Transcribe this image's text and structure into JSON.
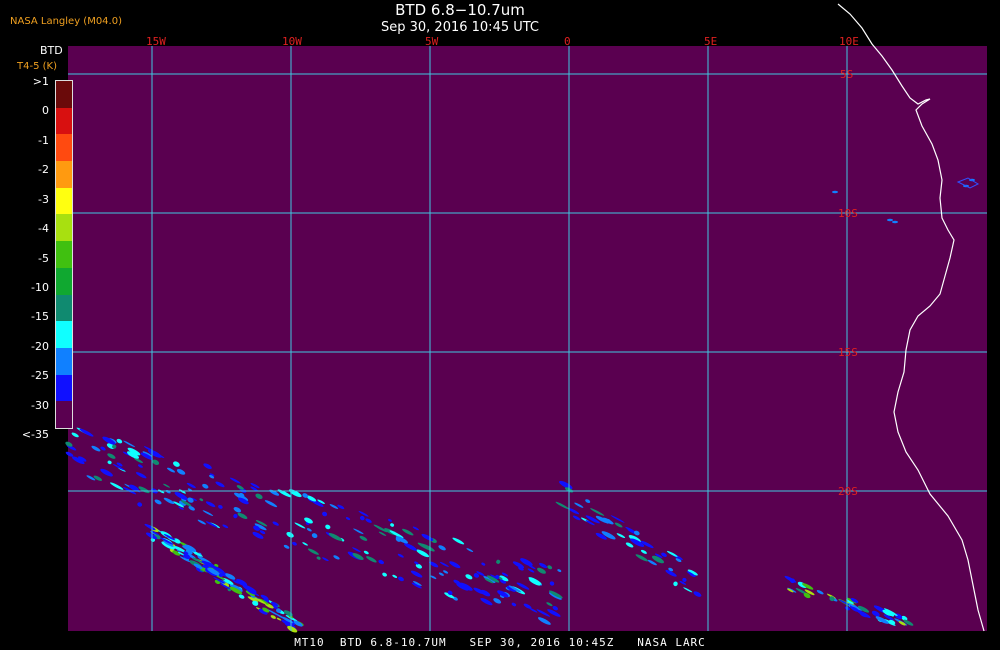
{
  "header": {
    "org": "NASA Langley (M04.0)",
    "title": "BTD 6.8−10.7um",
    "timestamp": "Sep 30, 2016 10:45 UTC"
  },
  "legend": {
    "title": "BTD",
    "subtitle": "T4-5 (K)",
    "labels": [
      ">1",
      "0",
      "-1",
      "-2",
      "-3",
      "-4",
      "-5",
      "-10",
      "-15",
      "-20",
      "-25",
      "-30",
      "<-35"
    ],
    "colors": [
      "#6a0a0a",
      "#d81010",
      "#ff4a10",
      "#ff9a10",
      "#ffff10",
      "#a8e010",
      "#40c010",
      "#10a830",
      "#108a70",
      "#10ffff",
      "#1080ff",
      "#1010ff",
      "#5a0050"
    ]
  },
  "map": {
    "background_color": "#5a0050",
    "grid_color": "#40c8e0",
    "coast_color": "#ffffff",
    "label_color": "#e02020",
    "lon_labels": [
      "15W",
      "10W",
      "5W",
      "0",
      "5E",
      "10E"
    ],
    "lat_labels": [
      "5S",
      "10S",
      "15S",
      "20S"
    ]
  },
  "footer": {
    "text": "MT10  BTD 6.8-10.7UM   SEP 30, 2016 10:45Z   NASA LARC"
  }
}
